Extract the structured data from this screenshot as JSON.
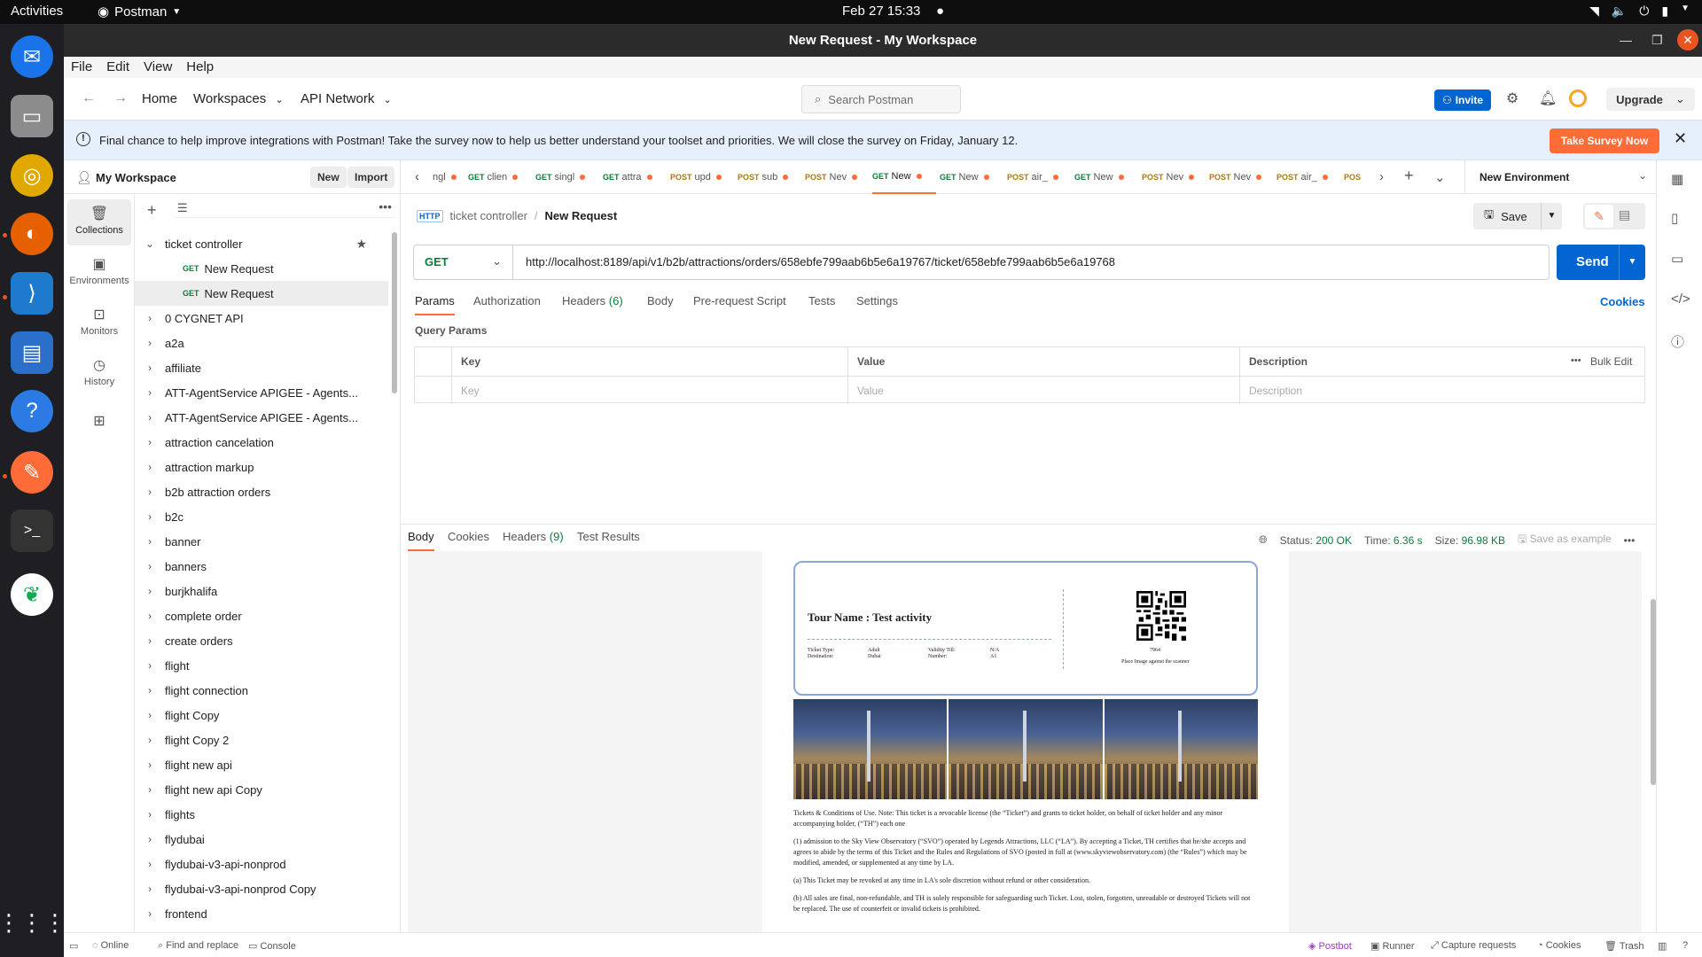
{
  "system": {
    "activities": "Activities",
    "app_name": "Postman",
    "clock": "Feb 27  15:33"
  },
  "window": {
    "title": "New Request - My Workspace"
  },
  "menu": [
    "File",
    "Edit",
    "View",
    "Help"
  ],
  "header": {
    "home": "Home",
    "workspaces": "Workspaces",
    "api_network": "API Network",
    "search_placeholder": "Search Postman",
    "invite": "Invite",
    "upgrade": "Upgrade"
  },
  "banner": {
    "text": "Final chance to help improve integrations with Postman! Take the survey now to help us better understand your toolset and priorities. We will close the survey on Friday, January 12.",
    "button": "Take Survey Now"
  },
  "workspace": {
    "name": "My Workspace",
    "new_btn": "New",
    "import_btn": "Import"
  },
  "rail": [
    {
      "label": "Collections",
      "icon": "collections-icon"
    },
    {
      "label": "Environments",
      "icon": "environments-icon"
    },
    {
      "label": "Monitors",
      "icon": "monitors-icon"
    },
    {
      "label": "History",
      "icon": "history-icon"
    }
  ],
  "tree": {
    "open_collection": "ticket controller",
    "requests": [
      {
        "method": "GET",
        "name": "New Request"
      },
      {
        "method": "GET",
        "name": "New Request"
      }
    ],
    "collections": [
      "0 CYGNET API",
      "a2a",
      "affiliate",
      "ATT-AgentService APIGEE - Agents...",
      "ATT-AgentService APIGEE - Agents...",
      "attraction cancelation",
      "attraction markup",
      "b2b attraction orders",
      "b2c",
      "banner",
      "banners",
      "burjkhalifa",
      "complete order",
      "create orders",
      "flight",
      "flight connection",
      "flight Copy",
      "flight Copy 2",
      "flight new api",
      "flight new api Copy",
      "flights",
      "flydubai",
      "flydubai-v3-api-nonprod",
      "flydubai-v3-api-nonprod Copy",
      "frontend"
    ]
  },
  "tabs": [
    {
      "method": "",
      "name": "ngl"
    },
    {
      "method": "GET",
      "name": "clien"
    },
    {
      "method": "GET",
      "name": "singl"
    },
    {
      "method": "GET",
      "name": "attra"
    },
    {
      "method": "POST",
      "name": "upd"
    },
    {
      "method": "POST",
      "name": "sub"
    },
    {
      "method": "POST",
      "name": "Nev"
    },
    {
      "method": "GET",
      "name": "New"
    },
    {
      "method": "GET",
      "name": "New"
    },
    {
      "method": "POST",
      "name": "air_"
    },
    {
      "method": "GET",
      "name": "New"
    },
    {
      "method": "POST",
      "name": "Nev"
    },
    {
      "method": "POST",
      "name": "Nev"
    },
    {
      "method": "POST",
      "name": "air_"
    },
    {
      "method": "POS",
      "name": ""
    }
  ],
  "environment": "New Environment",
  "request": {
    "collection": "ticket controller",
    "name": "New Request",
    "save": "Save",
    "method": "GET",
    "url": "http://localhost:8189/api/v1/b2b/attractions/orders/658ebfe799aab6b5e6a19767/ticket/658ebfe799aab6b5e6a19768",
    "send": "Send",
    "tabs": [
      "Params",
      "Authorization",
      "Headers",
      "Body",
      "Pre-request Script",
      "Tests",
      "Settings"
    ],
    "headers_count": "(6)",
    "cookies": "Cookies",
    "query_params_label": "Query Params",
    "columns": [
      "Key",
      "Value",
      "Description"
    ],
    "placeholders": [
      "Key",
      "Value",
      "Description"
    ],
    "bulk_edit": "Bulk Edit"
  },
  "response": {
    "tabs": [
      "Body",
      "Cookies",
      "Headers",
      "Test Results"
    ],
    "headers_count": "(9)",
    "status_label": "Status:",
    "status": "200 OK",
    "time_label": "Time:",
    "time": "6.36 s",
    "size_label": "Size:",
    "size": "96.98 KB",
    "save_example": "Save as example"
  },
  "ticket": {
    "tour_name": "Tour Name : Test activity",
    "ticket_type_label": "Ticket Type:",
    "ticket_type": "Adult",
    "destination_label": "Destination:",
    "destination": "Dubai",
    "validity_label": "Validity Till:",
    "validity": "N/A",
    "number_label": "Number:",
    "number": "A1",
    "qr_number": "7964",
    "qr_text": "Place Image against the scanner",
    "terms": [
      "Tickets & Conditions of Use. Note: This ticket is a revocable license (the “Ticket”) and grants to ticket holder, on behalf of ticket holder and any minor accompanying holder, (“TH”) each one",
      "(1) admission to the Sky View Observatory (“SVO”) operated by Legends Attractions, LLC (“LA”). By accepting a Ticket, TH certifies that he/she accepts and agrees to abide by the terms of this Ticket and the Rules and Regulations of SVO (posted in full at (www.skyviewobservatory.com) (the “Rules”) which may be modified, amended, or supplemented at any time by LA.",
      "(a) This Ticket may be revoked at any time in LA's sole discretion without refund or other consideration.",
      "(b) All sales are final, non-refundable, and TH is solely responsible for safeguarding such Ticket. Lost, stolen, forgotten, unreadable or destroyed Tickets will not be replaced. The use of counterfeit or invalid tickets is prohibited."
    ]
  },
  "statusbar": {
    "online": "Online",
    "find_replace": "Find and replace",
    "console": "Console",
    "postbot": "Postbot",
    "runner": "Runner",
    "capture": "Capture requests",
    "cookies": "Cookies",
    "trash": "Trash"
  },
  "colors": {
    "accent": "#ff6c37",
    "primary": "#0265d2",
    "get": "#0a7d3a",
    "post": "#ad7a03"
  }
}
